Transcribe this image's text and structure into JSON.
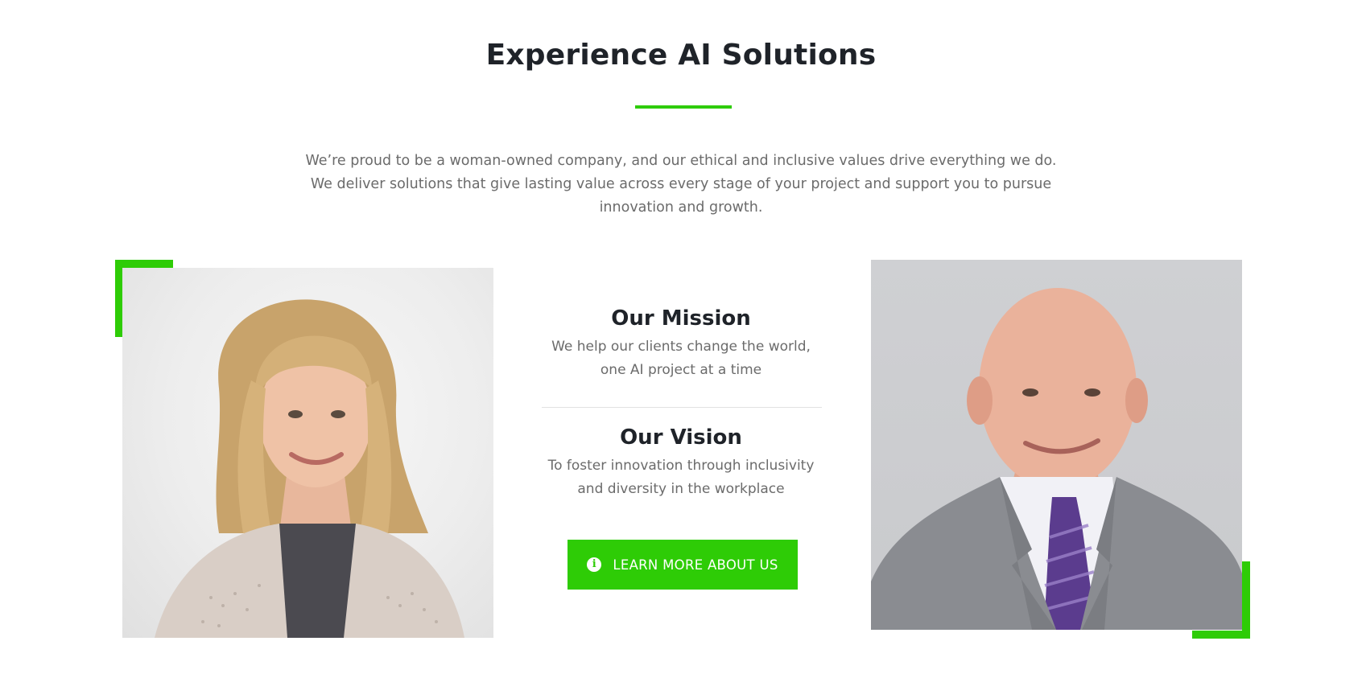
{
  "section": {
    "title": "Experience AI Solutions",
    "intro_lines": [
      "We’re proud to be a woman-owned company, and our ethical and inclusive values drive everything we do.",
      "We deliver solutions that give lasting value across every stage of your project and support you to pursue",
      "innovation and growth."
    ]
  },
  "mission": {
    "heading": "Our Mission",
    "lines": [
      "We help our clients change the world,",
      "one AI project at a time"
    ]
  },
  "vision": {
    "heading": "Our Vision",
    "lines": [
      "To foster innovation through inclusivity",
      "and diversity in the workplace"
    ]
  },
  "cta": {
    "label": "LEARN MORE ABOUT US",
    "icon": "info-icon"
  },
  "images": {
    "left_alt": "",
    "right_alt": ""
  },
  "colors": {
    "accent": "#2ecc06",
    "heading": "#1f2329",
    "body_text": "#6b6b6b"
  }
}
